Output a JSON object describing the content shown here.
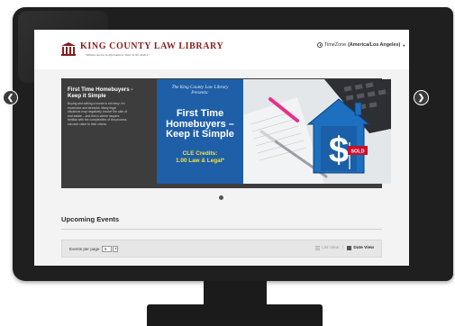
{
  "header": {
    "logo_title_line1": "KING COUNTY LAW LIBRARY",
    "logo_title_display": "King County Law Library",
    "logo_tagline": "\"Without Access to Information, There Is No Justice\"",
    "timezone_label": "TimeZone",
    "timezone_value": "(America/Los Angeles)",
    "timezone_caret": "▼"
  },
  "slide": {
    "title": "First Time Homebuyers - Keep it Simple",
    "description": "Buying and selling a house is not easy; it's expensive and stressful. Many legal situations may negatively involve the sale of real estate – and this is where lawyers familiar with the complexities of the process can add value to their clients.",
    "banner_presents_line1": "The King County Law Library",
    "banner_presents_line2": "Presents:",
    "banner_title": "First Time Homebuyers – Keep it Simple",
    "banner_cle_line1": "CLE Credits:",
    "banner_cle_line2": "1.00 Law & Legal*",
    "sign_text": "SOLD",
    "prev_symbol": "❮",
    "next_symbol": "❯"
  },
  "events": {
    "heading": "Upcoming Events",
    "per_page_label": "Events per page",
    "per_page_value": "5",
    "per_page_caret": "▾",
    "list_view_label": "List View",
    "separator": "|",
    "date_view_label": "Date View"
  },
  "colors": {
    "brand_red": "#8a1c1c",
    "banner_blue": "#1f5fa8",
    "cle_yellow": "#f2e33a",
    "slider_bg": "#3d3d3d"
  },
  "icons": {
    "clock": "clock-icon",
    "prev": "chevron-left-icon",
    "next": "chevron-right-icon",
    "list": "list-view-icon",
    "date": "date-view-icon"
  }
}
